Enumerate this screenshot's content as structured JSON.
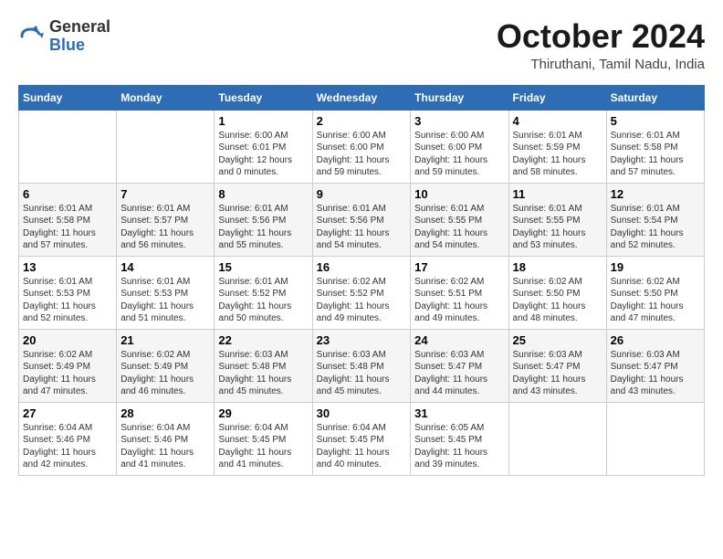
{
  "header": {
    "logo_general": "General",
    "logo_blue": "Blue",
    "month_title": "October 2024",
    "subtitle": "Thiruthani, Tamil Nadu, India"
  },
  "days_of_week": [
    "Sunday",
    "Monday",
    "Tuesday",
    "Wednesday",
    "Thursday",
    "Friday",
    "Saturday"
  ],
  "weeks": [
    [
      {
        "num": "",
        "info": ""
      },
      {
        "num": "",
        "info": ""
      },
      {
        "num": "1",
        "info": "Sunrise: 6:00 AM\nSunset: 6:01 PM\nDaylight: 12 hours\nand 0 minutes."
      },
      {
        "num": "2",
        "info": "Sunrise: 6:00 AM\nSunset: 6:00 PM\nDaylight: 11 hours\nand 59 minutes."
      },
      {
        "num": "3",
        "info": "Sunrise: 6:00 AM\nSunset: 6:00 PM\nDaylight: 11 hours\nand 59 minutes."
      },
      {
        "num": "4",
        "info": "Sunrise: 6:01 AM\nSunset: 5:59 PM\nDaylight: 11 hours\nand 58 minutes."
      },
      {
        "num": "5",
        "info": "Sunrise: 6:01 AM\nSunset: 5:58 PM\nDaylight: 11 hours\nand 57 minutes."
      }
    ],
    [
      {
        "num": "6",
        "info": "Sunrise: 6:01 AM\nSunset: 5:58 PM\nDaylight: 11 hours\nand 57 minutes."
      },
      {
        "num": "7",
        "info": "Sunrise: 6:01 AM\nSunset: 5:57 PM\nDaylight: 11 hours\nand 56 minutes."
      },
      {
        "num": "8",
        "info": "Sunrise: 6:01 AM\nSunset: 5:56 PM\nDaylight: 11 hours\nand 55 minutes."
      },
      {
        "num": "9",
        "info": "Sunrise: 6:01 AM\nSunset: 5:56 PM\nDaylight: 11 hours\nand 54 minutes."
      },
      {
        "num": "10",
        "info": "Sunrise: 6:01 AM\nSunset: 5:55 PM\nDaylight: 11 hours\nand 54 minutes."
      },
      {
        "num": "11",
        "info": "Sunrise: 6:01 AM\nSunset: 5:55 PM\nDaylight: 11 hours\nand 53 minutes."
      },
      {
        "num": "12",
        "info": "Sunrise: 6:01 AM\nSunset: 5:54 PM\nDaylight: 11 hours\nand 52 minutes."
      }
    ],
    [
      {
        "num": "13",
        "info": "Sunrise: 6:01 AM\nSunset: 5:53 PM\nDaylight: 11 hours\nand 52 minutes."
      },
      {
        "num": "14",
        "info": "Sunrise: 6:01 AM\nSunset: 5:53 PM\nDaylight: 11 hours\nand 51 minutes."
      },
      {
        "num": "15",
        "info": "Sunrise: 6:01 AM\nSunset: 5:52 PM\nDaylight: 11 hours\nand 50 minutes."
      },
      {
        "num": "16",
        "info": "Sunrise: 6:02 AM\nSunset: 5:52 PM\nDaylight: 11 hours\nand 49 minutes."
      },
      {
        "num": "17",
        "info": "Sunrise: 6:02 AM\nSunset: 5:51 PM\nDaylight: 11 hours\nand 49 minutes."
      },
      {
        "num": "18",
        "info": "Sunrise: 6:02 AM\nSunset: 5:50 PM\nDaylight: 11 hours\nand 48 minutes."
      },
      {
        "num": "19",
        "info": "Sunrise: 6:02 AM\nSunset: 5:50 PM\nDaylight: 11 hours\nand 47 minutes."
      }
    ],
    [
      {
        "num": "20",
        "info": "Sunrise: 6:02 AM\nSunset: 5:49 PM\nDaylight: 11 hours\nand 47 minutes."
      },
      {
        "num": "21",
        "info": "Sunrise: 6:02 AM\nSunset: 5:49 PM\nDaylight: 11 hours\nand 46 minutes."
      },
      {
        "num": "22",
        "info": "Sunrise: 6:03 AM\nSunset: 5:48 PM\nDaylight: 11 hours\nand 45 minutes."
      },
      {
        "num": "23",
        "info": "Sunrise: 6:03 AM\nSunset: 5:48 PM\nDaylight: 11 hours\nand 45 minutes."
      },
      {
        "num": "24",
        "info": "Sunrise: 6:03 AM\nSunset: 5:47 PM\nDaylight: 11 hours\nand 44 minutes."
      },
      {
        "num": "25",
        "info": "Sunrise: 6:03 AM\nSunset: 5:47 PM\nDaylight: 11 hours\nand 43 minutes."
      },
      {
        "num": "26",
        "info": "Sunrise: 6:03 AM\nSunset: 5:47 PM\nDaylight: 11 hours\nand 43 minutes."
      }
    ],
    [
      {
        "num": "27",
        "info": "Sunrise: 6:04 AM\nSunset: 5:46 PM\nDaylight: 11 hours\nand 42 minutes."
      },
      {
        "num": "28",
        "info": "Sunrise: 6:04 AM\nSunset: 5:46 PM\nDaylight: 11 hours\nand 41 minutes."
      },
      {
        "num": "29",
        "info": "Sunrise: 6:04 AM\nSunset: 5:45 PM\nDaylight: 11 hours\nand 41 minutes."
      },
      {
        "num": "30",
        "info": "Sunrise: 6:04 AM\nSunset: 5:45 PM\nDaylight: 11 hours\nand 40 minutes."
      },
      {
        "num": "31",
        "info": "Sunrise: 6:05 AM\nSunset: 5:45 PM\nDaylight: 11 hours\nand 39 minutes."
      },
      {
        "num": "",
        "info": ""
      },
      {
        "num": "",
        "info": ""
      }
    ]
  ]
}
